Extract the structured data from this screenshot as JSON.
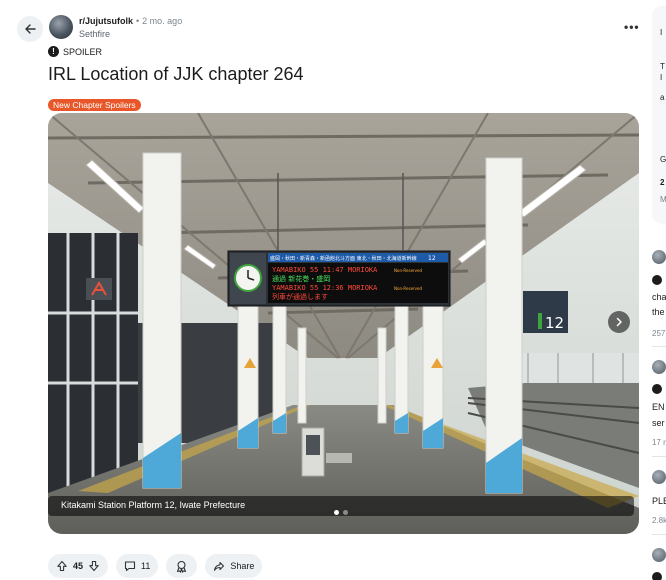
{
  "post": {
    "subreddit": "r/Jujutsufolk",
    "separator": "•",
    "age": "2 mo. ago",
    "author": "Sethfire",
    "spoiler_label": "SPOILER",
    "title": "IRL Location of JJK chapter 264",
    "flair": "New Chapter Spoilers",
    "flair_color": "#e8562a",
    "more_label": "•••"
  },
  "media": {
    "caption": "Kitakami Station Platform 12, Iwate Prefecture",
    "page_count": 2,
    "active_page": 1,
    "board_header": "盛岡・秋田・新青森・新函館北斗方面 東北・秋田・北海道新幹線",
    "board_line_1": "YAMABIKO 55 11:47 MORIOKA",
    "board_line_2": "通過 新花巻・盛岡",
    "board_line_3": "YAMABIKO 55 12:36 MORIOKA",
    "board_line_4": "列車が通過します",
    "board_reserved": "Non-Reserved",
    "board_track": "12",
    "platform_sign": "12"
  },
  "actions": {
    "vote_count": "45",
    "comment_count": "11",
    "share_label": "Share"
  },
  "sidebar": {
    "card_letters": [
      "I",
      "T",
      "I",
      "a",
      "G",
      "2",
      "M"
    ],
    "items": [
      {
        "text": "cha",
        "text2": "the",
        "meta": "257"
      },
      {
        "text": "EN",
        "text2": "ser",
        "meta": "17 r"
      },
      {
        "text": "PLE",
        "meta": "2.8k"
      }
    ]
  }
}
